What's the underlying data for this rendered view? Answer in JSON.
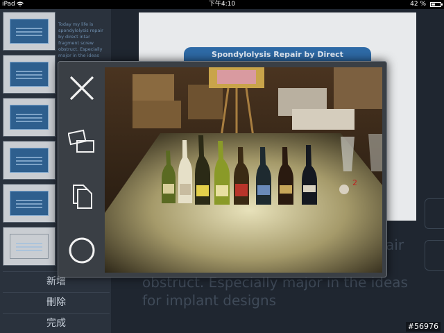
{
  "statusbar": {
    "device": "iPad",
    "time": "下午4:10",
    "battery": "42 %",
    "battery_level": 0.42
  },
  "sidebar": {
    "thumb_note": "Today my life is spondylolysis repair by direct intar fragment screw obstruct. Especially major in the ideas",
    "thumbnails": [
      {
        "label": ""
      },
      {
        "label": ""
      },
      {
        "label": ""
      },
      {
        "label": ""
      },
      {
        "label": ""
      },
      {
        "label": ""
      }
    ],
    "actions": [
      "新增",
      "刪除",
      "完成"
    ]
  },
  "slide": {
    "title": "Spondylolysis Repair by Direct",
    "body_fragment_right": "air",
    "body_line1": "obstruct. Especially major in the ideas",
    "body_line2": "for implant designs"
  },
  "overlay": {
    "tools": [
      {
        "name": "close-icon"
      },
      {
        "name": "switch-slides-icon"
      },
      {
        "name": "copy-icon"
      },
      {
        "name": "circle-icon"
      }
    ],
    "photo_labels": [
      "2"
    ]
  },
  "watermark": "#56976"
}
